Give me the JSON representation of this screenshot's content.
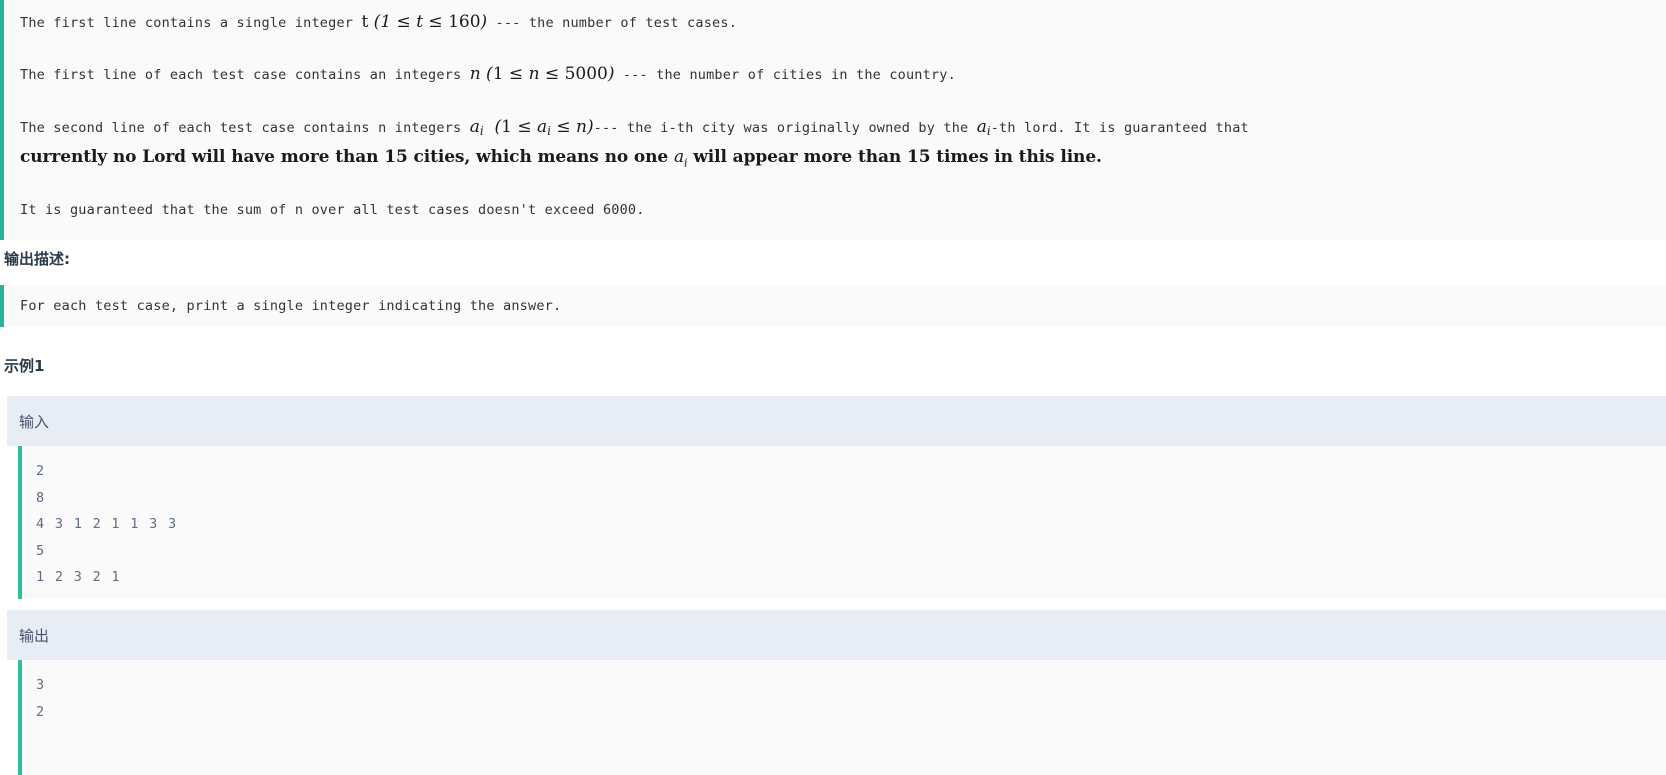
{
  "input_description": {
    "lines": [
      {
        "id": "line-t",
        "pre": "The first line contains a single integer ",
        "math": "t (1 ≤ t ≤ 160)",
        "post": " --- the number of test cases."
      },
      {
        "id": "line-n",
        "pre": "The first line of each test case contains an integers ",
        "math": "n (1 ≤ n ≤ 5000)",
        "post": " --- the number of cities in the country."
      },
      {
        "id": "line-a",
        "pre": "The second line of each test case contains n integers ",
        "math": "aᵢ (1 ≤ aᵢ ≤ n)",
        "post": "--- the i-th city was originally owned by the aᵢ-th lord. It is guaranteed that"
      },
      {
        "id": "line-bold",
        "text": "currently no Lord will have more than 15 cities, which means no one aᵢ will appear more than 15 times in this line."
      },
      {
        "id": "line-sum",
        "text": "It is guaranteed that the sum of n over all test cases doesn't exceed 6000."
      }
    ]
  },
  "output_description": {
    "heading": "输出描述:",
    "text": "For each test case, print a single integer indicating the answer."
  },
  "example": {
    "heading": "示例1",
    "input": {
      "label": "输入",
      "lines": [
        "2",
        "8",
        "4 3 1 2 1 1 3 3",
        "5",
        "1 2 3 2 1"
      ]
    },
    "output": {
      "label": "输出",
      "lines": [
        "3",
        "2"
      ]
    }
  },
  "colors": {
    "accent_green": "#26B49A",
    "code_bg": "#FAFAFA",
    "io_header_bg": "#E8EDF5",
    "heading_text": "#2B3A4A",
    "code_text": "#5E6E85",
    "body_text": "#333333"
  }
}
